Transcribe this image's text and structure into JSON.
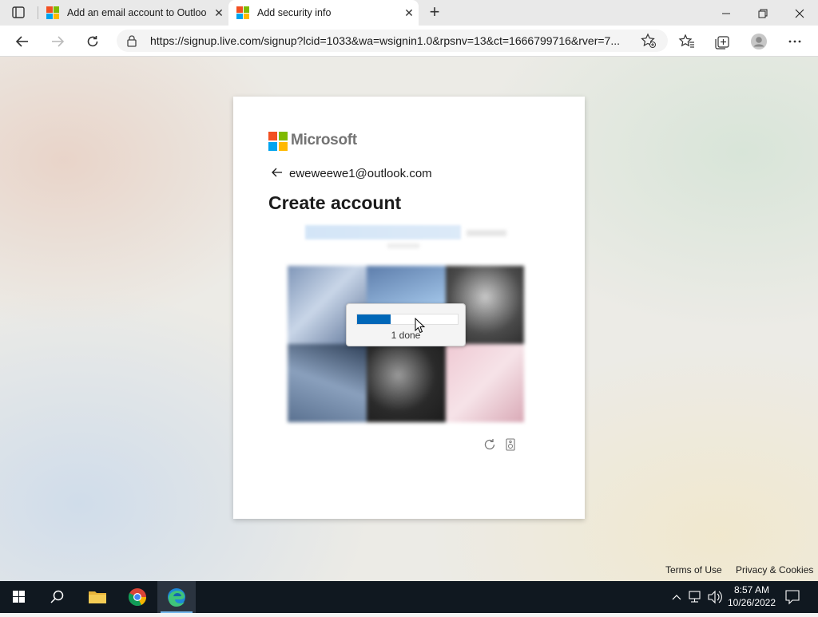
{
  "browser": {
    "tabs": [
      {
        "title": "Add an email account to Outloo",
        "active": false
      },
      {
        "title": "Add security info",
        "active": true
      }
    ],
    "close_label": "✕",
    "newtab_label": "+",
    "window_controls": {
      "minimize": "—",
      "restore": "❐",
      "close": "✕"
    },
    "address": {
      "url": "https://signup.live.com/signup?lcid=1033&wa=wsignin1.0&rpsnv=13&ct=1666799716&rver=7..."
    }
  },
  "card": {
    "logo_text": "Microsoft",
    "identity": "eweweewe1@outlook.com",
    "heading": "Create account",
    "progress": {
      "fraction": 0.33,
      "label": "1 done"
    }
  },
  "footer": {
    "terms": "Terms of Use",
    "privacy": "Privacy & Cookies"
  },
  "taskbar": {
    "time": "8:57 AM",
    "date": "10/26/2022"
  },
  "colors": {
    "accent": "#0067b8",
    "ms_red": "#f25022",
    "ms_green": "#7fba00",
    "ms_blue": "#00a4ef",
    "ms_yellow": "#ffb900"
  }
}
